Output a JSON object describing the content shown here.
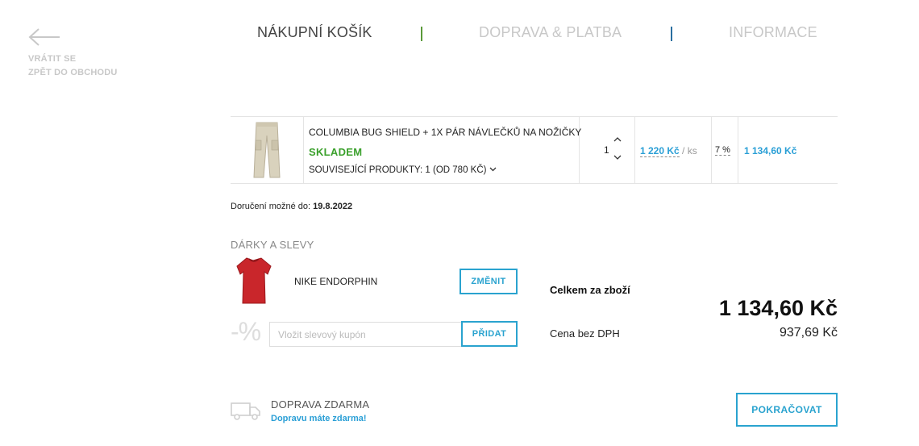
{
  "back": {
    "line1": "VRÁTIT SE",
    "line2": "ZPĚT DO OBCHODU",
    "icon": "arrow-left-icon"
  },
  "steps": [
    {
      "label": "NÁKUPNÍ KOŠÍK",
      "active": true
    },
    {
      "label": "DOPRAVA & PLATBA",
      "active": false
    },
    {
      "label": "INFORMACE",
      "active": false
    }
  ],
  "cart": {
    "item": {
      "name": "COLUMBIA BUG SHIELD + 1X PÁR NÁVLEČKŮ NA NOŽIČKY",
      "stock": "SKLADEM",
      "related": "SOUVISEJÍCÍ PRODUKTY: 1 (OD 780 KČ)",
      "quantity": "1",
      "unit_price": "1 220 Kč",
      "unit_suffix": "/ ks",
      "vat": "7 %",
      "total": "1 134,60 Kč"
    }
  },
  "delivery": {
    "label": "Doručení možné do:",
    "date": "19.8.2022"
  },
  "gifts": {
    "title": "DÁRKY A SLEVY",
    "gift_name": "NIKE ENDORPHIN",
    "change_label": "ZMĚNIT",
    "coupon_symbol": "-%",
    "coupon_placeholder": "Vložit slevový kupón",
    "add_label": "PŘIDAT"
  },
  "summary": {
    "total_label": "Celkem za zboží",
    "total": "1 134,60 Kč",
    "novat_label": "Cena bez DPH",
    "novat": "937,69 Kč"
  },
  "shipping": {
    "title": "DOPRAVA ZDARMA",
    "subtitle": "Dopravu máte zdarma!",
    "icon": "truck-icon"
  },
  "continue_label": "POKRAČOVAT",
  "colors": {
    "accent": "#2aa3cf",
    "price_blue": "#2a9fd6",
    "stock_green": "#3aa02b"
  }
}
